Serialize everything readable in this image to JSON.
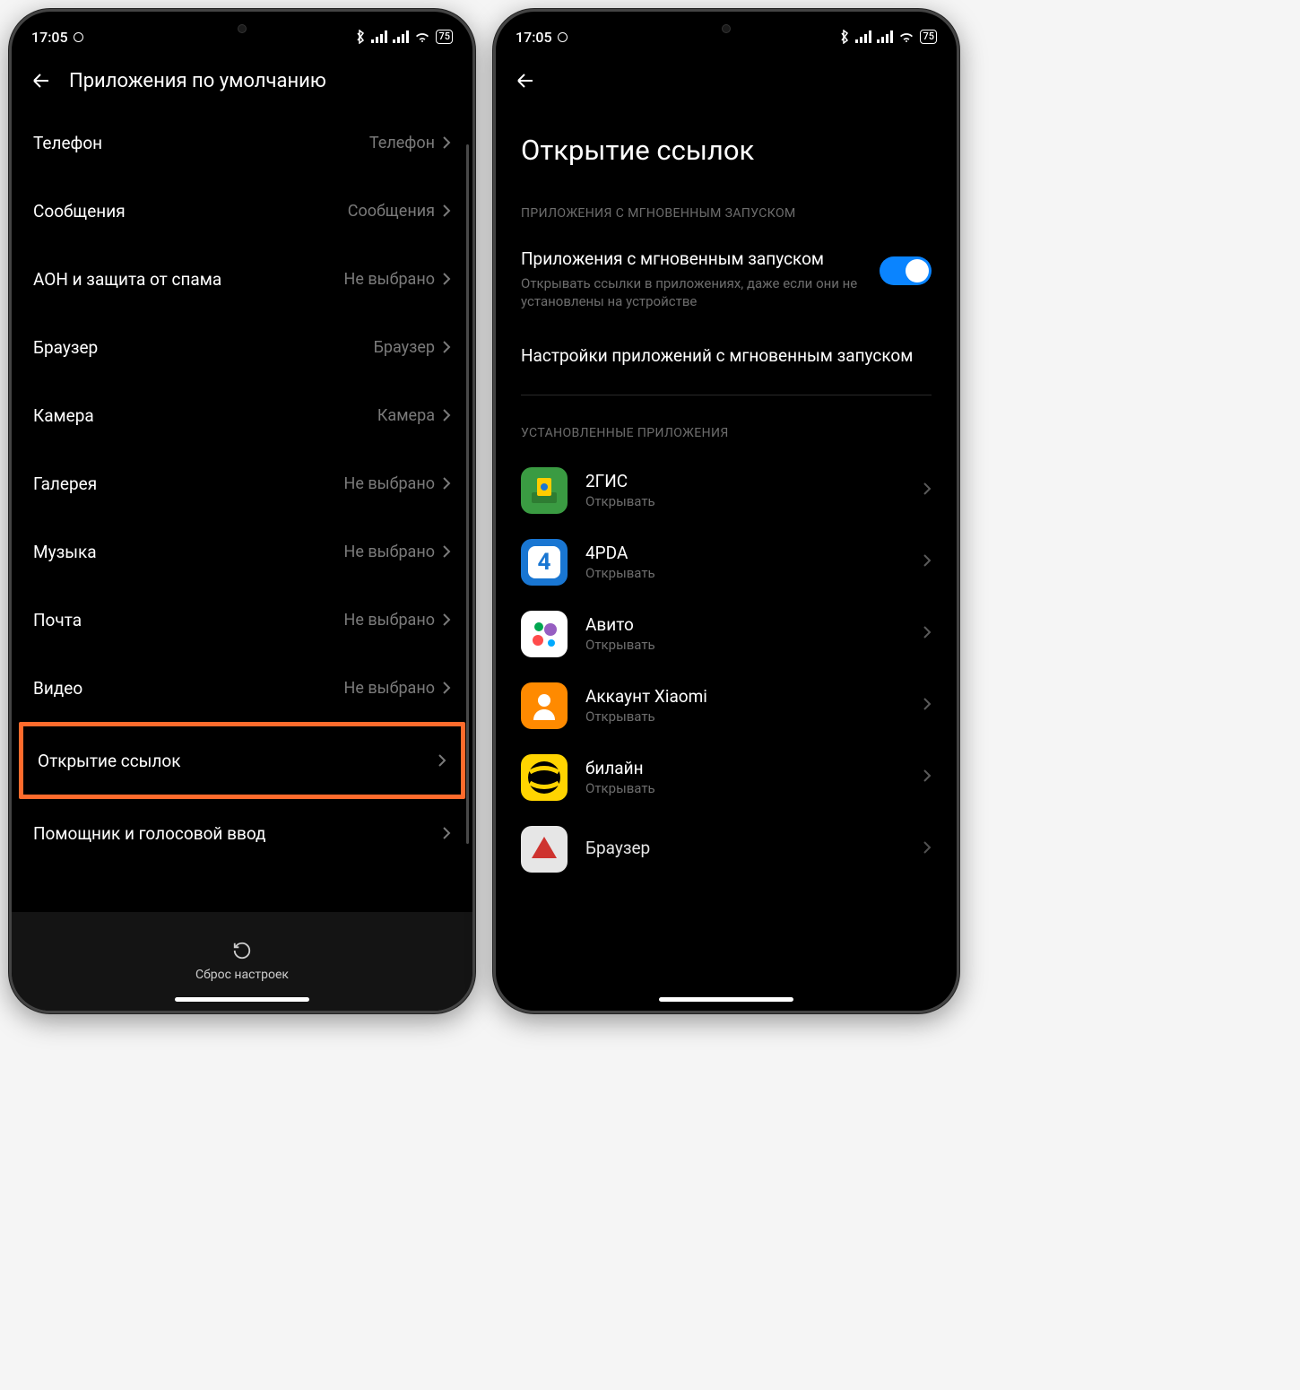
{
  "status": {
    "time": "17:05",
    "battery": "75"
  },
  "left": {
    "title": "Приложения по умолчанию",
    "items": [
      {
        "label": "Телефон",
        "value": "Телефон"
      },
      {
        "label": "Сообщения",
        "value": "Сообщения"
      },
      {
        "label": "АОН и защита от спама",
        "value": "Не выбрано"
      },
      {
        "label": "Браузер",
        "value": "Браузер"
      },
      {
        "label": "Камера",
        "value": "Камера"
      },
      {
        "label": "Галерея",
        "value": "Не выбрано"
      },
      {
        "label": "Музыка",
        "value": "Не выбрано"
      },
      {
        "label": "Почта",
        "value": "Не выбрано"
      },
      {
        "label": "Видео",
        "value": "Не выбрано"
      },
      {
        "label": "Открытие ссылок",
        "value": ""
      },
      {
        "label": "Помощник и голосовой ввод",
        "value": ""
      }
    ],
    "reset": "Сброс настроек"
  },
  "right": {
    "title": "Открытие ссылок",
    "section1": "ПРИЛОЖЕНИЯ С МГНОВЕННЫМ ЗАПУСКОМ",
    "toggle": {
      "title": "Приложения с мгновенным запуском",
      "sub": "Открывать ссылки в приложениях, даже если они не установлены на устройстве"
    },
    "settings_link": "Настройки приложений с мгновенным запуском",
    "section2": "УСТАНОВЛЕННЫЕ ПРИЛОЖЕНИЯ",
    "apps": [
      {
        "name": "2ГИС",
        "status": "Открывать",
        "icon_bg": "#3a9b42",
        "icon_fg": "#ffcc00"
      },
      {
        "name": "4PDA",
        "status": "Открывать",
        "icon_bg": "#1976d2",
        "icon_fg": "#fff"
      },
      {
        "name": "Авито",
        "status": "Открывать",
        "icon_bg": "#fff",
        "icon_fg": ""
      },
      {
        "name": "Аккаунт Xiaomi",
        "status": "Открывать",
        "icon_bg": "#ff8a00",
        "icon_fg": "#fff"
      },
      {
        "name": "билайн",
        "status": "Открывать",
        "icon_bg": "#ffd400",
        "icon_fg": "#000"
      },
      {
        "name": "Браузер",
        "status": "",
        "icon_bg": "#fff",
        "icon_fg": "#e53935"
      }
    ]
  }
}
